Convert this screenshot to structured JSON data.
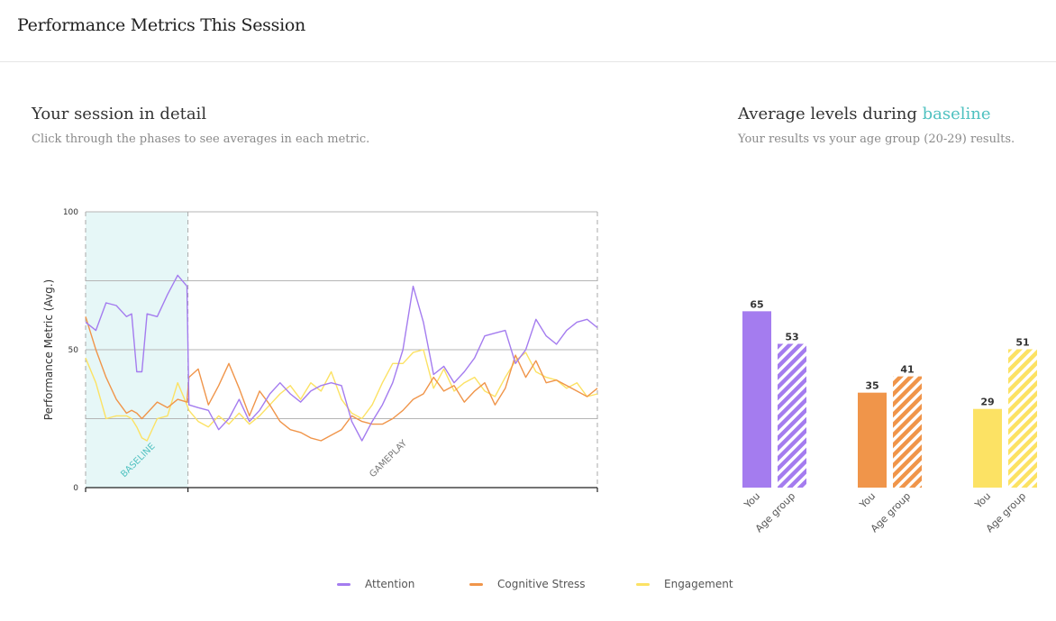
{
  "header": {
    "title": "Performance Metrics This Session"
  },
  "detail": {
    "title": "Your session in detail",
    "subtitle": "Click through the phases to see averages in each metric."
  },
  "averages": {
    "title_prefix": "Average levels during ",
    "title_phase": "baseline",
    "subtitle": "Your results vs your age group (20-29) results."
  },
  "colors": {
    "attention": "#a47cef",
    "cognitive_stress": "#f0954a",
    "engagement": "#fce264",
    "baseline_band": "#e6f7f7",
    "accent": "#4fc1c0"
  },
  "legend": [
    {
      "name": "Attention",
      "color": "#a47cef"
    },
    {
      "name": "Cognitive Stress",
      "color": "#f0954a"
    },
    {
      "name": "Engagement",
      "color": "#fce264"
    }
  ],
  "chart_data": [
    {
      "type": "line",
      "ylabel": "Performance Metric (Avg.)",
      "ylim": [
        0,
        100
      ],
      "yticks": [
        "100",
        "50",
        "0"
      ],
      "phases": [
        {
          "label": "BASELINE",
          "start": 0,
          "end": 20
        },
        {
          "label": "GAMEPLAY",
          "start": 20,
          "end": 100
        }
      ],
      "x": [
        0,
        2,
        4,
        6,
        8,
        9,
        10,
        11,
        12,
        14,
        16,
        18,
        19.8,
        20.2,
        22,
        24,
        26,
        28,
        30,
        32,
        34,
        36,
        38,
        40,
        42,
        44,
        46,
        48,
        50,
        52,
        54,
        56,
        58,
        60,
        62,
        64,
        66,
        68,
        70,
        72,
        74,
        76,
        78,
        80,
        82,
        84,
        86,
        88,
        90,
        92,
        94,
        96,
        98,
        100
      ],
      "series": [
        {
          "name": "Attention",
          "values": [
            60,
            57,
            67,
            66,
            62,
            63,
            42,
            42,
            63,
            62,
            70,
            77,
            73,
            30,
            29,
            28,
            21,
            25,
            32,
            24,
            28,
            34,
            38,
            34,
            31,
            35,
            37,
            38,
            37,
            24,
            17,
            24,
            30,
            38,
            50,
            73,
            60,
            41,
            44,
            38,
            42,
            47,
            55,
            56,
            57,
            45,
            50,
            61,
            55,
            52,
            57,
            60,
            61,
            58
          ]
        },
        {
          "name": "Cognitive Stress",
          "values": [
            62,
            50,
            40,
            32,
            27,
            28,
            27,
            25,
            27,
            31,
            29,
            32,
            31,
            40,
            43,
            30,
            37,
            45,
            36,
            26,
            35,
            30,
            24,
            21,
            20,
            18,
            17,
            19,
            21,
            26,
            24,
            23,
            23,
            25,
            28,
            32,
            34,
            40,
            35,
            37,
            31,
            35,
            38,
            30,
            36,
            48,
            40,
            46,
            38,
            39,
            37,
            35,
            33,
            36
          ]
        },
        {
          "name": "Engagement",
          "values": [
            47,
            38,
            25,
            26,
            26,
            25,
            22,
            18,
            17,
            25,
            26,
            38,
            30,
            28,
            24,
            22,
            26,
            23,
            27,
            23,
            26,
            30,
            34,
            37,
            32,
            38,
            35,
            42,
            32,
            27,
            25,
            30,
            38,
            45,
            45,
            49,
            50,
            36,
            43,
            35,
            38,
            40,
            35,
            33,
            40,
            46,
            49,
            42,
            40,
            39,
            36,
            38,
            33,
            34
          ]
        }
      ]
    },
    {
      "type": "bar",
      "categories": [
        "You",
        "Age group"
      ],
      "series": [
        {
          "name": "Attention",
          "values": [
            65,
            53
          ]
        },
        {
          "name": "Cognitive Stress",
          "values": [
            35,
            41
          ]
        },
        {
          "name": "Engagement",
          "values": [
            29,
            51
          ]
        }
      ],
      "ylim": [
        0,
        100
      ]
    }
  ]
}
